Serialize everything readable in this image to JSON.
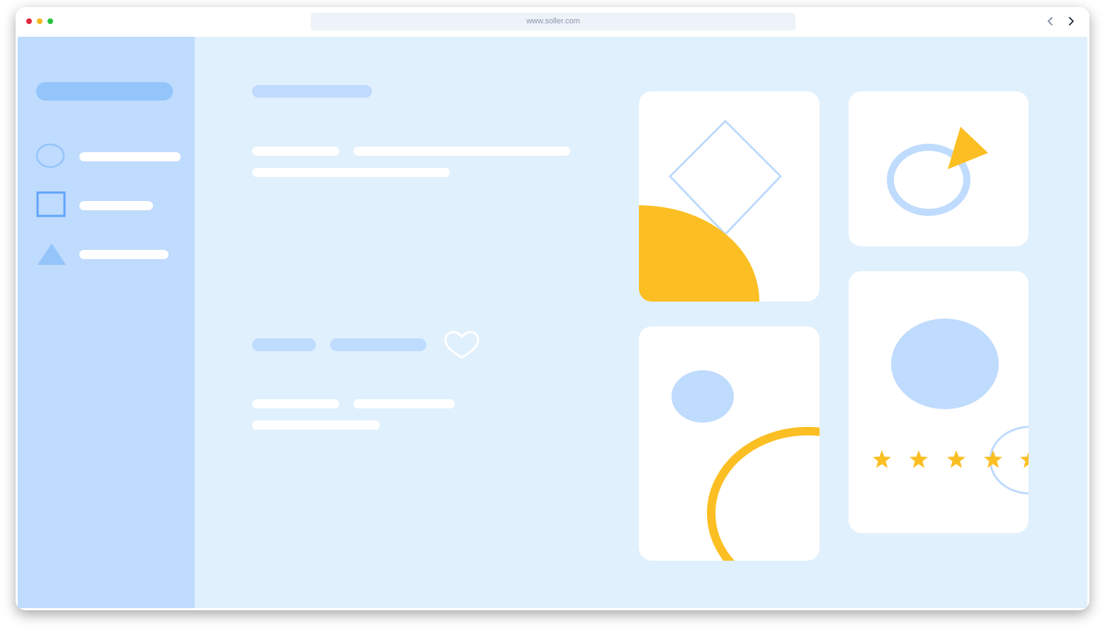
{
  "browser": {
    "url": "www.soller.com",
    "traffic_lights": [
      "#e0293d",
      "#f4b622",
      "#27c23e"
    ],
    "back_icon": "chevron-left-icon",
    "forward_icon": "chevron-right-icon"
  },
  "sidebar": {
    "items": [
      {
        "icon": "circle-outline-icon"
      },
      {
        "icon": "square-outline-icon"
      },
      {
        "icon": "triangle-icon"
      }
    ]
  },
  "content": {
    "favorite_icon": "heart-outline-icon"
  },
  "colors": {
    "sidebar_bg": "#bfdbfd",
    "content_bg": "#e0f0fd",
    "accent_yellow": "#fbbf24",
    "accent_blue": "#bfdbfd",
    "icon_blue": "#60a5fa"
  },
  "rating": {
    "stars_visible": 5
  }
}
